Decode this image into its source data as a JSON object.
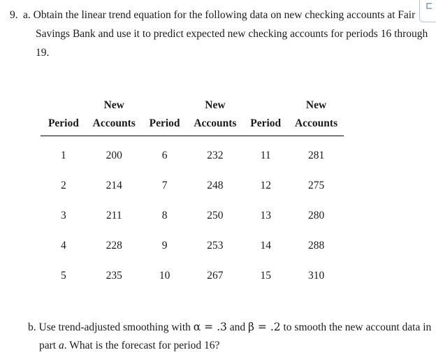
{
  "tool": {
    "icon": "crop-bracket-icon",
    "border_color": "#b9c3cf",
    "icon_color": "#9fb2c6"
  },
  "question": {
    "number": "9.",
    "part_a": "a. Obtain the linear trend equation for the following data on new checking accounts at Fair Savings Bank and use it to predict expected new checking accounts for periods 16 through 19.",
    "part_b_prefix": "b. Use trend-adjusted smoothing with ",
    "part_b_alpha": "α = .3",
    "part_b_and": " and ",
    "part_b_beta": "β = .2",
    "part_b_mid": " to smooth the new account data in part ",
    "part_b_italic": "a",
    "part_b_suffix": ". What is the forecast for period 16?"
  },
  "table": {
    "headers_top": [
      "",
      "New",
      "",
      "New",
      "",
      "New"
    ],
    "headers_bottom": [
      "Period",
      "Accounts",
      "Period",
      "Accounts",
      "Period",
      "Accounts"
    ],
    "rows": [
      [
        "1",
        "200",
        "6",
        "232",
        "11",
        "281"
      ],
      [
        "2",
        "214",
        "7",
        "248",
        "12",
        "275"
      ],
      [
        "3",
        "211",
        "8",
        "250",
        "13",
        "280"
      ],
      [
        "4",
        "228",
        "9",
        "253",
        "14",
        "288"
      ],
      [
        "5",
        "235",
        "10",
        "267",
        "15",
        "310"
      ]
    ]
  },
  "chart_data": {
    "type": "table",
    "title": "New checking accounts at Fair Savings Bank",
    "xlabel": "Period",
    "ylabel": "New Accounts",
    "x": [
      1,
      2,
      3,
      4,
      5,
      6,
      7,
      8,
      9,
      10,
      11,
      12,
      13,
      14,
      15
    ],
    "values": [
      200,
      214,
      211,
      228,
      235,
      232,
      248,
      250,
      253,
      267,
      281,
      275,
      280,
      288,
      310
    ],
    "categories": [
      "1",
      "2",
      "3",
      "4",
      "5",
      "6",
      "7",
      "8",
      "9",
      "10",
      "11",
      "12",
      "13",
      "14",
      "15"
    ],
    "series": [
      {
        "name": "New Accounts",
        "values": [
          200,
          214,
          211,
          228,
          235,
          232,
          248,
          250,
          253,
          267,
          281,
          275,
          280,
          288,
          310
        ]
      }
    ]
  }
}
